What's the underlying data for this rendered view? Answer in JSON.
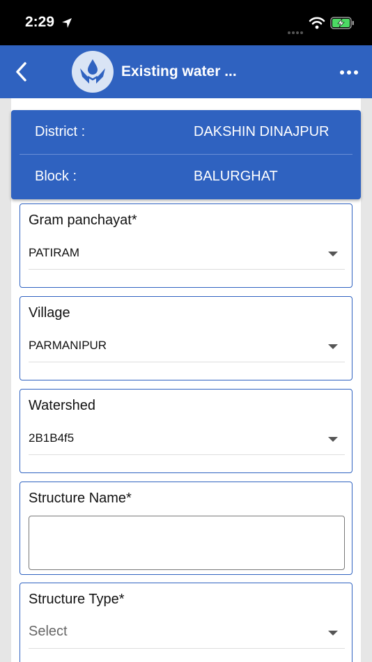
{
  "status_bar": {
    "time": "2:29"
  },
  "app_bar": {
    "title": "Existing water ..."
  },
  "info": {
    "district_label": "District :",
    "district_value": "DAKSHIN DINAJPUR",
    "block_label": "Block :",
    "block_value": "BALURGHAT"
  },
  "fields": {
    "gram_panchayat": {
      "label": "Gram panchayat*",
      "value": "PATIRAM"
    },
    "village": {
      "label": "Village",
      "value": "PARMANIPUR"
    },
    "watershed": {
      "label": "Watershed",
      "value": "2B1B4f5"
    },
    "structure_name": {
      "label": "Structure Name*",
      "value": ""
    },
    "structure_type": {
      "label": "Structure Type*",
      "value": "Select"
    }
  },
  "colors": {
    "primary": "#2f62c0",
    "background": "#e6e6e6",
    "battery": "#4cd964"
  },
  "icons": [
    "location-arrow-icon",
    "wifi-icon",
    "battery-charging-icon",
    "back-arrow-icon",
    "water-hands-logo-icon",
    "more-dots-icon",
    "caret-down-icon"
  ]
}
